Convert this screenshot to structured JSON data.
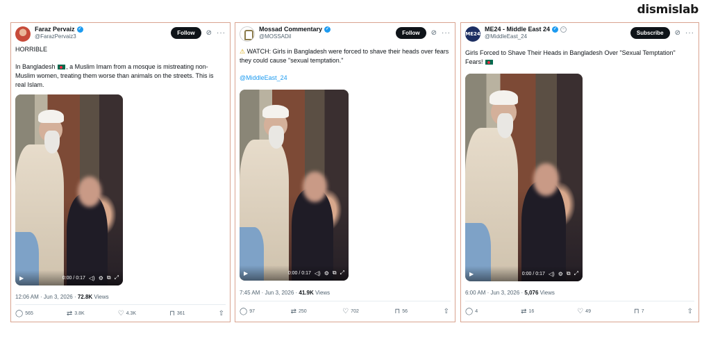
{
  "brand": "dismislab",
  "cards": [
    {
      "name": "Faraz Pervaiz",
      "handle": "@FarazPervaiz3",
      "button": "Follow",
      "text_lines": [
        "HORRIBLE",
        ", a Muslim Imam from a mosque is mistreating non-Muslim women, treating them worse than animals on the streets. This is real Islam."
      ],
      "text_prefix": "In Bangladesh",
      "video_time": "0:00 / 0:17",
      "timestamp": "12:06 AM · Jun 3, 2026 · ",
      "views_count": "72.8K",
      "views_label": " Views",
      "replies": "565",
      "reposts": "3.8K",
      "likes": "4.3K",
      "bookmarks": "361"
    },
    {
      "name": "Mossad Commentary",
      "handle": "@MOSSADil",
      "button": "Follow",
      "warning_icon": "warning-icon",
      "text": " WATCH: Girls in Bangladesh were forced to shave their heads over fears they could cause \"sexual temptation.\"",
      "mention": "@MiddleEast_24",
      "video_time": "0:00 / 0:17",
      "timestamp": "7:45 AM · Jun 3, 2026 · ",
      "views_count": "41.9K",
      "views_label": " Views",
      "replies": "97",
      "reposts": "250",
      "likes": "702",
      "bookmarks": "56"
    },
    {
      "name": "ME24 - Middle East 24",
      "avatar_text": "ME24",
      "handle": "@MiddleEast_24",
      "button": "Subscribe",
      "text": "Girls Forced to Shave Their Heads in Bangladesh Over \"Sexual Temptation\" Fears! ",
      "video_time": "0:00 / 0:17",
      "timestamp": "6:00 AM · Jun 3, 2026 · ",
      "views_count": "5,076",
      "views_label": " Views",
      "replies": "4",
      "reposts": "16",
      "likes": "49",
      "bookmarks": "7"
    }
  ],
  "colors": {
    "card_border": "#d9a38f",
    "verified": "#1d9bf0",
    "button_bg": "#0f1419",
    "muted_text": "#536471"
  }
}
